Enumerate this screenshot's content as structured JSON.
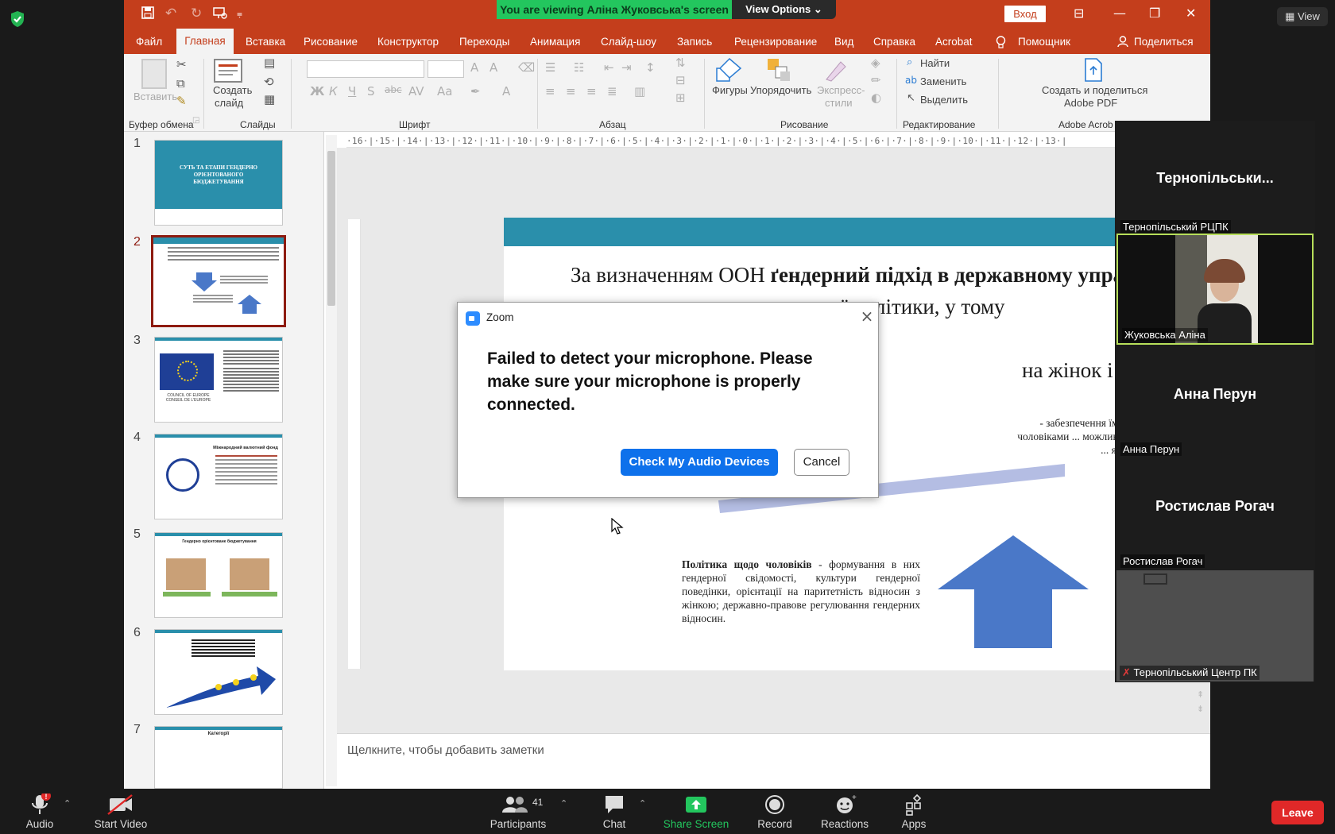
{
  "zoom": {
    "viewing_banner": "You are viewing Аліна Жуковська's screen",
    "view_options": "View Options",
    "view_button": "View",
    "leave": "Leave"
  },
  "ppt": {
    "login": "Вход",
    "menu": [
      "Файл",
      "Главная",
      "Вставка",
      "Рисование",
      "Конструктор",
      "Переходы",
      "Анимация",
      "Слайд-шоу",
      "Запись",
      "Рецензирование",
      "Вид",
      "Справка",
      "Acrobat",
      "Помощник",
      "Поделиться"
    ],
    "ribbon": {
      "paste": "Вставить",
      "new_slide_1": "Создать",
      "new_slide_2": "слайд",
      "shapes": "Фигуры",
      "arrange": "Упорядочить",
      "express_1": "Экспресс-",
      "express_2": "стили",
      "find": "Найти",
      "replace": "Заменить",
      "select": "Выделить",
      "adobe_1": "Создать и поделиться",
      "adobe_2": "Adobe PDF",
      "groups": {
        "clipboard": "Буфер обмена",
        "slides": "Слайды",
        "font": "Шрифт",
        "paragraph": "Абзац",
        "drawing": "Рисование",
        "editing": "Редактирование",
        "acrobat": "Adobe Acrob"
      }
    },
    "ruler_h": "·16·|·15·|·14·|·13·|·12·|·11·|·10·|·9·|·8·|·7·|·6·|·5·|·4·|·3·|·2·|·1·|·0·|·1·|·2·|·3·|·4·|·5·|·6·|·7·|·8·|·9·|·10·|·11·|·12·|·13·|",
    "thumbnails": [
      {
        "num": "1",
        "title": "СУТЬ ТА ЕТАПИ ГЕНДЕРНО ОРІЄНТОВАНОГО БЮДЖЕТУВАННЯ"
      },
      {
        "num": "2"
      },
      {
        "num": "3",
        "caption": "COUNCIL OF EUROPE   CONSEIL DE L'EUROPE"
      },
      {
        "num": "4",
        "caption": "Міжнародний валютний фонд"
      },
      {
        "num": "5",
        "caption": "Гендерно орієнтоване бюджетування"
      },
      {
        "num": "6"
      },
      {
        "num": "7",
        "caption": "Категорії"
      }
    ],
    "slide": {
      "line1_normal": "За визначенням ООН ",
      "line1_bold": "ґендерний підхід в державному управлінні",
      "line2": "— це врахування ... державної політики, у тому",
      "line3": "чи ... програм, у всіх сферах і",
      "line4": "на жінок і чоловіків.",
      "para_right": "- забезпечення їм ... статусу з чоловіками ... можливостей для їх ... як соціально-",
      "para_bold": "Політика щодо чоловіків",
      "para_rest": " - формування в них гендерної свідомості, культури гендерної поведінки, орієнтації на паритетність відносин з жінкою; державно-правове регулювання гендерних відносин."
    },
    "notes_placeholder": "Щелкните, чтобы добавить заметки"
  },
  "dialog": {
    "title": "Zoom",
    "message": "Failed to detect your microphone. Please make sure your microphone is properly connected.",
    "check_button": "Check My Audio Devices",
    "cancel_button": "Cancel"
  },
  "gallery": [
    {
      "big_name": "Тернопільськи...",
      "caption": "Тернопільський РЦПК",
      "video": false
    },
    {
      "big_name": "",
      "caption": "Жуковська Аліна",
      "video": true,
      "active": true
    },
    {
      "big_name": "Анна Перун",
      "caption": "Анна Перун",
      "video": false
    },
    {
      "big_name": "Ростислав Рогач",
      "caption": "Ростислав Рогач",
      "video": false
    },
    {
      "big_name": "",
      "caption": "Тернопільський Центр ПК",
      "video": true,
      "muted": true
    }
  ],
  "toolbar": {
    "audio": "Audio",
    "start_video": "Start Video",
    "participants": "Participants",
    "participants_count": "41",
    "chat": "Chat",
    "share_screen": "Share Screen",
    "record": "Record",
    "reactions": "Reactions",
    "apps": "Apps"
  },
  "colors": {
    "ppt_accent": "#c43e1c",
    "slide_band": "#2a8fab",
    "arrow_blue": "#4a78c8",
    "banner_green": "#23c65e",
    "zoom_blue": "#0e71eb",
    "leave_red": "#e02828"
  }
}
